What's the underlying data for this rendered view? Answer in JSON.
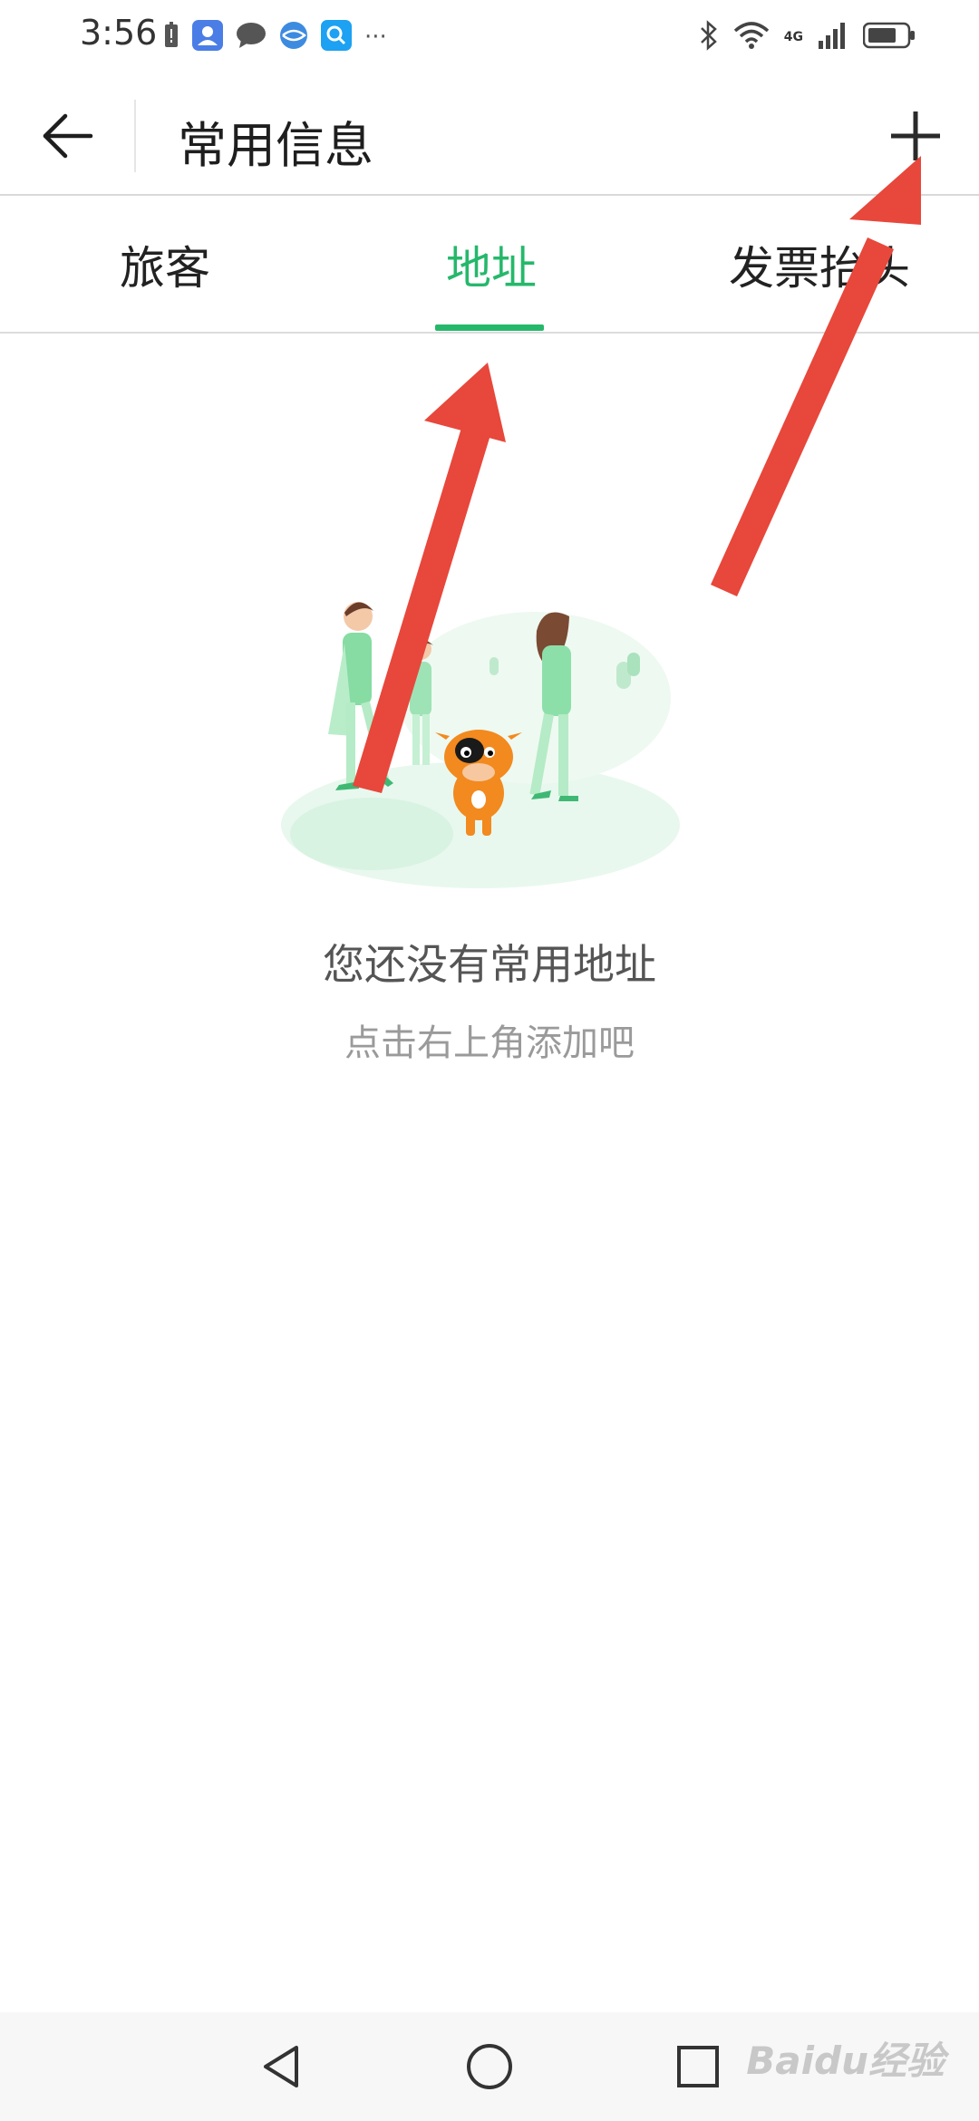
{
  "status_bar": {
    "time": "3:56",
    "left_icons": [
      "battery-alert-icon",
      "contacts-app-icon",
      "chat-bubble-icon",
      "browser-icon",
      "search-app-icon",
      "more-dots-icon"
    ],
    "more_label": "···",
    "network_label": "4G",
    "right_icons": [
      "bluetooth-icon",
      "wifi-icon",
      "signal-icon",
      "battery-icon"
    ]
  },
  "header": {
    "title": "常用信息",
    "back_icon": "arrow-left-icon",
    "add_icon": "plus-icon"
  },
  "tabs": {
    "items": [
      {
        "label": "旅客",
        "active": false
      },
      {
        "label": "地址",
        "active": true
      },
      {
        "label": "发票抬头",
        "active": false
      }
    ],
    "active_color": "#25b86b"
  },
  "empty_state": {
    "title": "您还没有常用地址",
    "subtitle": "点击右上角添加吧"
  },
  "nav_bar": {
    "icons": [
      "nav-back-icon",
      "nav-home-icon",
      "nav-recent-icon"
    ]
  },
  "watermark": {
    "text": "Baidu经验"
  },
  "annotation_color": "#e8473b"
}
